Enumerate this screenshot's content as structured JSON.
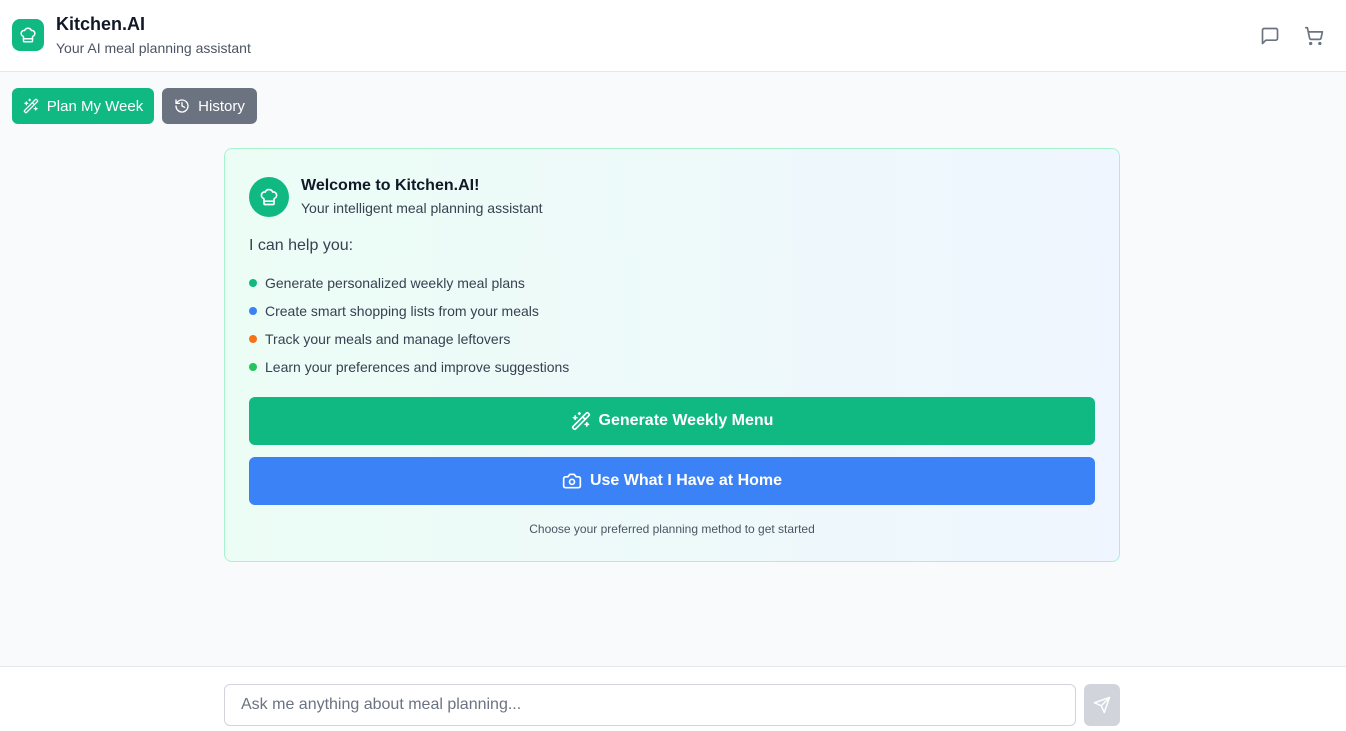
{
  "header": {
    "title": "Kitchen.AI",
    "subtitle": "Your AI meal planning assistant",
    "icons": [
      "chef-hat-icon",
      "message-square-icon",
      "shopping-cart-icon"
    ]
  },
  "toolbar": {
    "plan_label": "Plan My Week",
    "history_label": "History"
  },
  "welcome": {
    "title": "Welcome to Kitchen.AI!",
    "subtitle": "Your intelligent meal planning assistant",
    "intro": "I can help you:",
    "features": [
      {
        "text": "Generate personalized weekly meal plans",
        "color": "#10b981"
      },
      {
        "text": "Create smart shopping lists from your meals",
        "color": "#3b82f6"
      },
      {
        "text": "Track your meals and manage leftovers",
        "color": "#f97316"
      },
      {
        "text": "Learn your preferences and improve suggestions",
        "color": "#22c55e"
      }
    ],
    "generate_label": "Generate Weekly Menu",
    "home_label": "Use What I Have at Home",
    "hint": "Choose your preferred planning method to get started"
  },
  "chat": {
    "placeholder": "Ask me anything about meal planning...",
    "value": ""
  },
  "colors": {
    "accent": "#10b981",
    "secondary": "#3b82f6",
    "muted": "#6b7280"
  }
}
